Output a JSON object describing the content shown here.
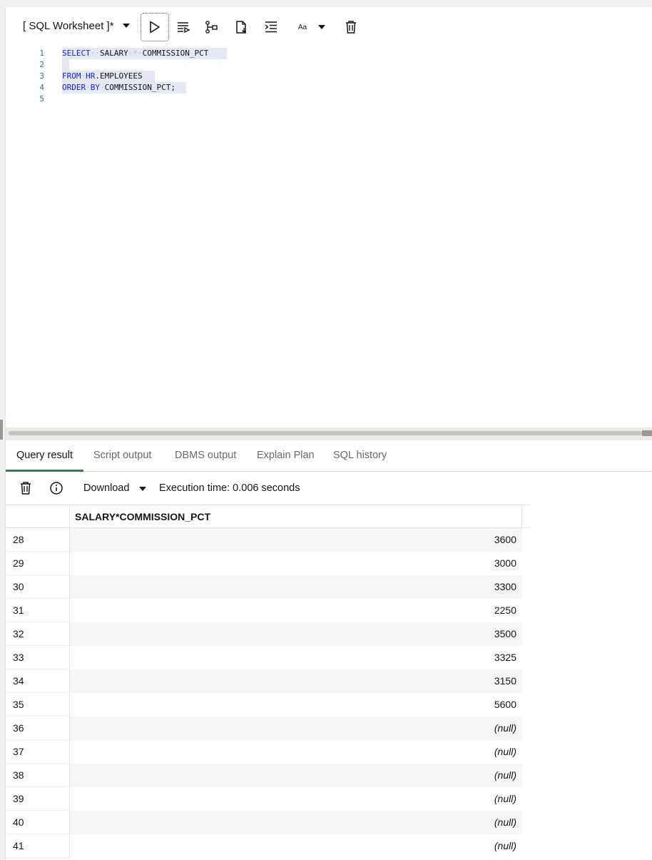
{
  "toolbar": {
    "worksheet_title": "[ SQL Worksheet ]*",
    "font_button_label": "Aa"
  },
  "editor": {
    "line_numbers": [
      "1",
      "2",
      "3",
      "4",
      "5"
    ],
    "lines": {
      "l1": {
        "kw1": "SELECT",
        "id1": "SALARY",
        "op": "*",
        "id2": "COMMISSION_PCT"
      },
      "l3": {
        "kw1": "FROM",
        "kw2": "HR",
        "id1": ".EMPLOYEES"
      },
      "l4": {
        "kw1": "ORDER",
        "kw2": "BY",
        "id1": "COMMISSION_PCT;"
      }
    }
  },
  "tabs": [
    "Query result",
    "Script output",
    "DBMS output",
    "Explain Plan",
    "SQL history"
  ],
  "result_toolbar": {
    "download_label": "Download",
    "execution_time": "Execution time: 0.006 seconds"
  },
  "grid": {
    "column_header": "SALARY*COMMISSION_PCT",
    "rows": [
      {
        "n": "28",
        "v": "3600"
      },
      {
        "n": "29",
        "v": "3000"
      },
      {
        "n": "30",
        "v": "3300"
      },
      {
        "n": "31",
        "v": "2250"
      },
      {
        "n": "32",
        "v": "3500"
      },
      {
        "n": "33",
        "v": "3325"
      },
      {
        "n": "34",
        "v": "3150"
      },
      {
        "n": "35",
        "v": "5600"
      },
      {
        "n": "36",
        "v": "(null)"
      },
      {
        "n": "37",
        "v": "(null)"
      },
      {
        "n": "38",
        "v": "(null)"
      },
      {
        "n": "39",
        "v": "(null)"
      },
      {
        "n": "40",
        "v": "(null)"
      },
      {
        "n": "41",
        "v": "(null)"
      }
    ]
  },
  "colors": {
    "keyword": "#1a1af0",
    "line_number": "#237893",
    "active_tab_underline": "#3f7556",
    "selection": "#e3e8f3"
  }
}
